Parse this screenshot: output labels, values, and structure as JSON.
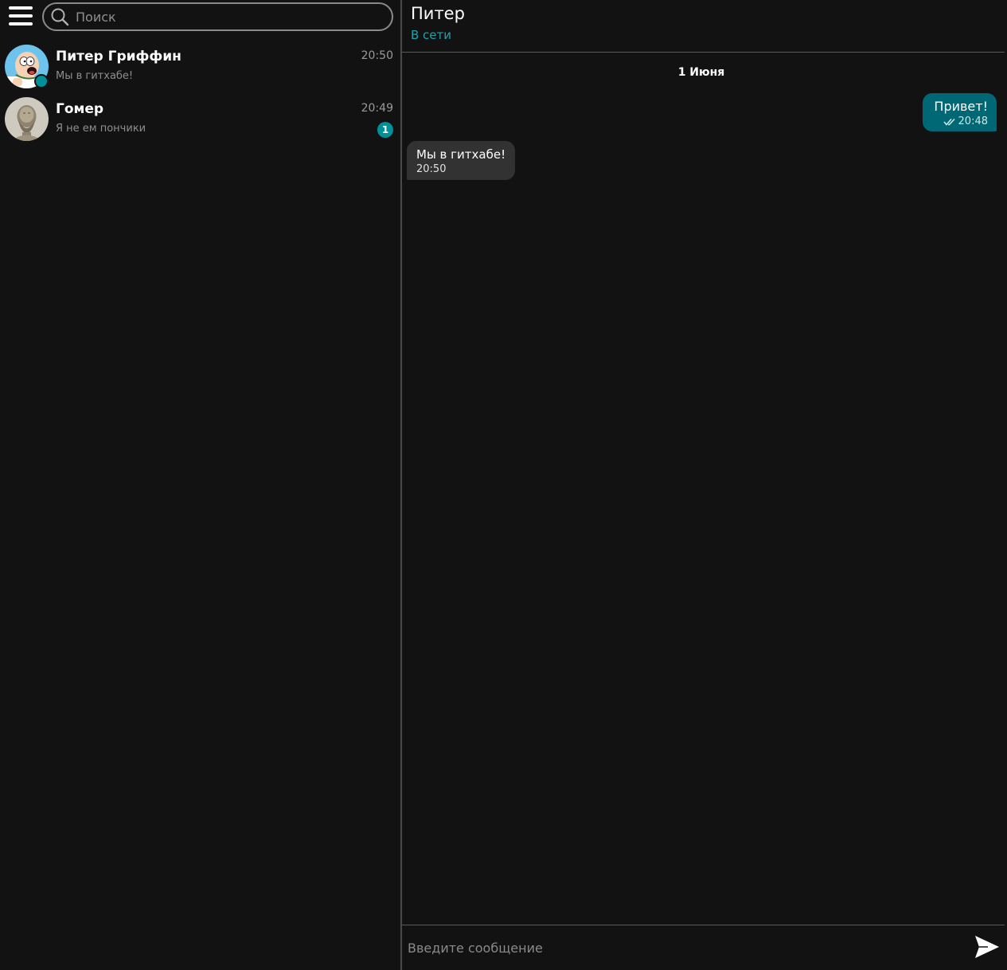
{
  "sidebar": {
    "search": {
      "placeholder": "Поиск"
    },
    "chats": [
      {
        "name": "Питер Гриффин",
        "preview": "Мы в гитхабе!",
        "time": "20:50",
        "online": true
      },
      {
        "name": "Гомер",
        "preview": "Я не ем пончики",
        "time": "20:49",
        "unread": "1"
      }
    ]
  },
  "header": {
    "name": "Питер",
    "status": "В сети",
    "status_color": "#1fa3ac"
  },
  "conversation": {
    "date": "1 Июня",
    "messages": [
      {
        "direction": "outgoing",
        "text": "Привет!",
        "time": "20:48",
        "status_icon": "double-check-icon"
      },
      {
        "direction": "incoming",
        "text": "Мы в гитхабе!",
        "time": "20:50"
      }
    ]
  },
  "composer": {
    "placeholder": "Введите сообщение"
  },
  "colors": {
    "background": "#121212",
    "accent": "#00909a",
    "outgoing_bubble": "#006874",
    "incoming_bubble": "#323232"
  }
}
